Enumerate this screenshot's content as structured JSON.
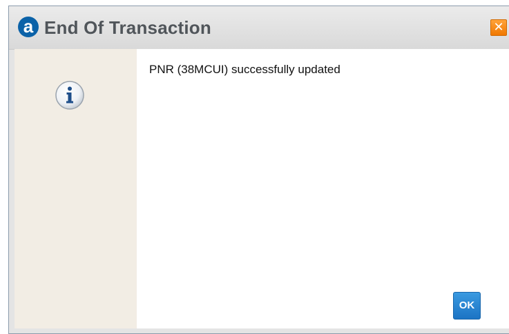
{
  "dialog": {
    "logo_letter": "a",
    "title": "End Of Transaction",
    "close_glyph": "✕",
    "message": "PNR (38MCUI) successfully updated",
    "ok_label": "OK",
    "icon": "info-icon"
  },
  "colors": {
    "logo": "#0b62a8",
    "close_button": "#f58a1f",
    "ok_button": "#2a86d2",
    "icon_column": "#f2ede4"
  }
}
